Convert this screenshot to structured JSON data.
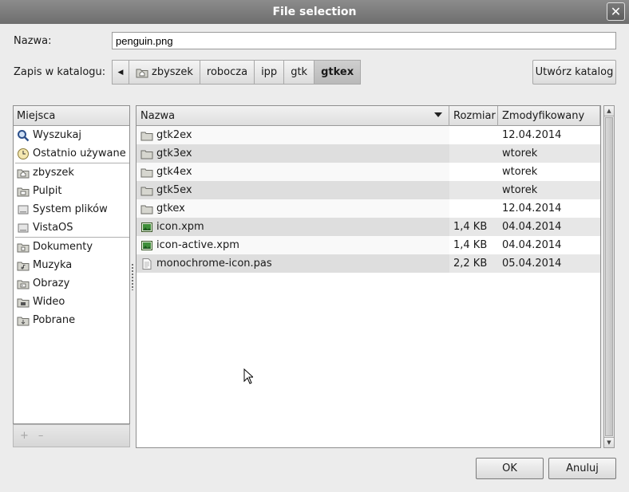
{
  "window": {
    "title": "File selection",
    "close_glyph": "✕"
  },
  "form": {
    "name_label": "Nazwa:",
    "name_value": "penguin.png",
    "folder_label": "Zapis w katalogu:",
    "create_folder": "Utwórz katalog"
  },
  "pathbar": {
    "crumbs": [
      "zbyszek",
      "robocza",
      "ipp",
      "gtk",
      "gtkex"
    ]
  },
  "places": {
    "header": "Miejsca",
    "items": [
      {
        "label": "Wyszukaj",
        "icon": "search-icon"
      },
      {
        "label": "Ostatnio używane",
        "icon": "recent-clock-icon"
      },
      {
        "label": "zbyszek",
        "icon": "home-folder-icon"
      },
      {
        "label": "Pulpit",
        "icon": "desktop-folder-icon"
      },
      {
        "label": "System plików",
        "icon": "drive-icon"
      },
      {
        "label": "VistaOS",
        "icon": "drive-icon"
      },
      {
        "label": "Dokumenty",
        "icon": "documents-folder-icon"
      },
      {
        "label": "Muzyka",
        "icon": "music-folder-icon"
      },
      {
        "label": "Obrazy",
        "icon": "pictures-folder-icon"
      },
      {
        "label": "Wideo",
        "icon": "video-folder-icon"
      },
      {
        "label": "Pobrane",
        "icon": "downloads-folder-icon"
      }
    ],
    "add_glyph": "+",
    "remove_glyph": "–"
  },
  "files": {
    "columns": {
      "name": "Nazwa",
      "size": "Rozmiar",
      "modified": "Zmodyfikowany"
    },
    "rows": [
      {
        "name": "gtk2ex",
        "size": "",
        "modified": "12.04.2014",
        "icon": "folder-icon"
      },
      {
        "name": "gtk3ex",
        "size": "",
        "modified": "wtorek",
        "icon": "folder-icon"
      },
      {
        "name": "gtk4ex",
        "size": "",
        "modified": "wtorek",
        "icon": "folder-icon"
      },
      {
        "name": "gtk5ex",
        "size": "",
        "modified": "wtorek",
        "icon": "folder-icon"
      },
      {
        "name": "gtkex",
        "size": "",
        "modified": "12.04.2014",
        "icon": "folder-icon"
      },
      {
        "name": "icon.xpm",
        "size": "1,4 KB",
        "modified": "04.04.2014",
        "icon": "image-file-icon"
      },
      {
        "name": "icon-active.xpm",
        "size": "1,4 KB",
        "modified": "04.04.2014",
        "icon": "image-file-icon"
      },
      {
        "name": "monochrome-icon.pas",
        "size": "2,2 KB",
        "modified": "05.04.2014",
        "icon": "text-file-icon"
      }
    ]
  },
  "buttons": {
    "ok": "OK",
    "cancel": "Anuluj"
  }
}
